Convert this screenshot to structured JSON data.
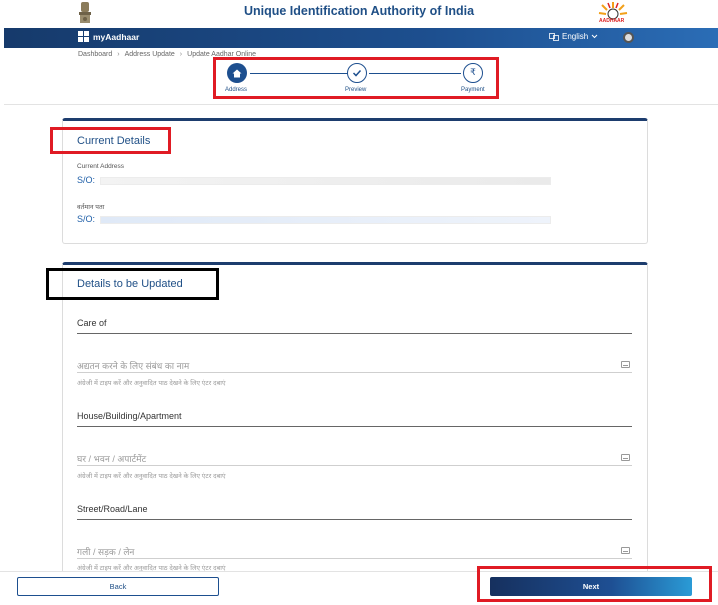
{
  "header": {
    "title": "Unique Identification Authority of India",
    "logo_word": "AADHAAR"
  },
  "navbar": {
    "brand": "myAadhaar",
    "language": "English"
  },
  "breadcrumb": [
    "Dashboard",
    "Address Update",
    "Update Aadhar Online"
  ],
  "stepper": {
    "steps": [
      {
        "label": "Address",
        "icon": "home-icon",
        "state": "active"
      },
      {
        "label": "Preview",
        "icon": "check-icon",
        "state": "idle"
      },
      {
        "label": "Payment",
        "icon": "rupee-icon",
        "state": "idle"
      }
    ]
  },
  "current_details": {
    "title": "Current Details",
    "address_label": "Current Address",
    "address_value": "S/O:",
    "local_label": "वर्तमान पता",
    "local_value": "S/O:"
  },
  "update_details": {
    "title": "Details to be Updated",
    "fields": [
      {
        "label": "Care of",
        "placeholder": "अद्यतन करने के लिए संबंध का नाम",
        "hint": "अंग्रेजी में टाइप करें और अनुवादित पाठ देखने के लिए एंटर दबाएं"
      },
      {
        "label": "House/Building/Apartment",
        "placeholder": "घर / भवन / अपार्टमेंट",
        "hint": "अंग्रेजी में टाइप करें और अनुवादित पाठ देखने के लिए एंटर दबाएं"
      },
      {
        "label": "Street/Road/Lane",
        "placeholder": "गली / सड़क / लेन",
        "hint": "अंग्रेजी में टाइप करें और अनुवादित पाठ देखने के लिए एंटर दबाएं"
      }
    ]
  },
  "footer": {
    "back_label": "Back",
    "next_label": "Next"
  },
  "colors": {
    "brand_blue": "#1d4f8f",
    "highlight_red": "#e01b24"
  }
}
